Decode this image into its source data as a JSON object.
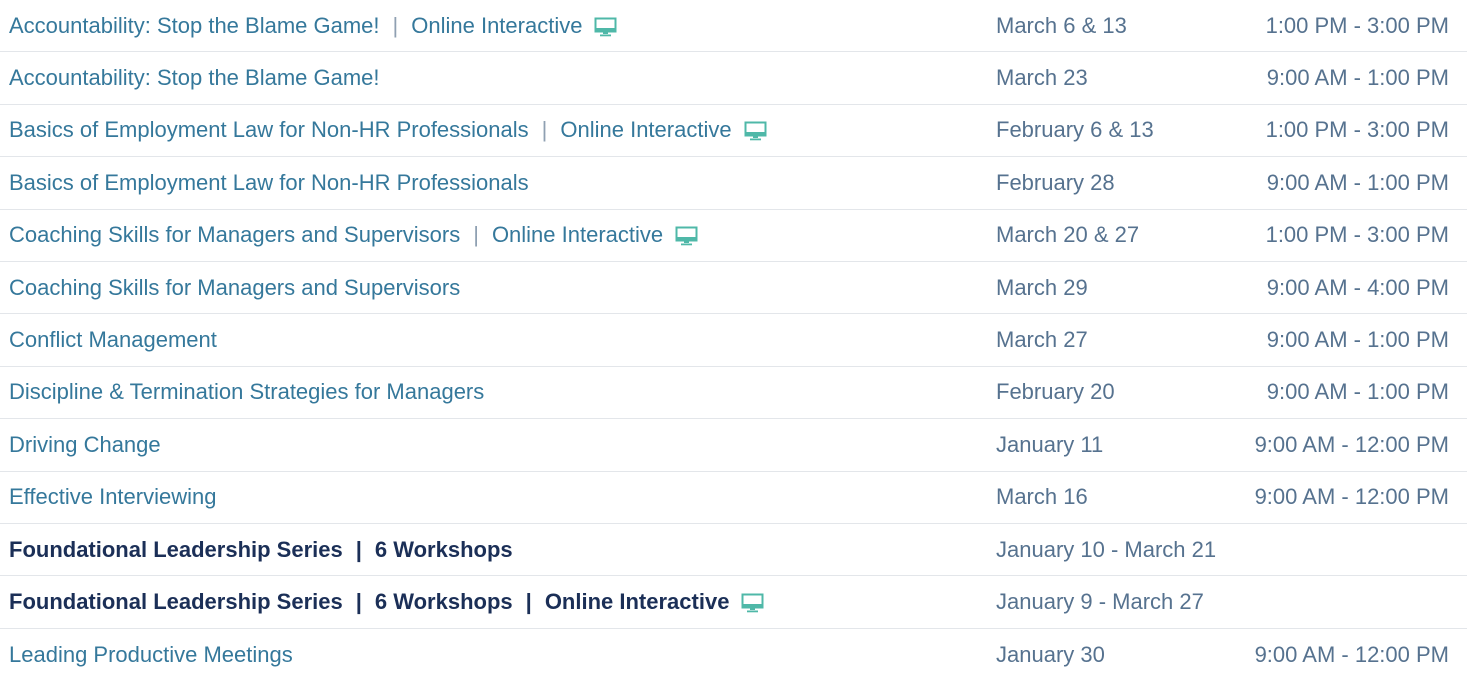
{
  "accent_color": "#4fb8a8",
  "rows": [
    {
      "title": "Accountability: Stop the Blame Game!",
      "series": "",
      "online": "Online Interactive",
      "date": "March 6 & 13",
      "time": "1:00 PM - 3:00 PM"
    },
    {
      "title": "Accountability: Stop the Blame Game!",
      "series": "",
      "online": "",
      "date": "March 23",
      "time": "9:00 AM - 1:00 PM"
    },
    {
      "title": "Basics of Employment Law for Non-HR Professionals",
      "series": "",
      "online": "Online Interactive",
      "date": "February 6 & 13",
      "time": "1:00 PM - 3:00 PM"
    },
    {
      "title": "Basics of Employment Law for Non-HR Professionals",
      "series": "",
      "online": "",
      "date": "February 28",
      "time": "9:00 AM - 1:00 PM"
    },
    {
      "title": "Coaching Skills for Managers and Supervisors",
      "series": "",
      "online": "Online Interactive",
      "date": "March 20 & 27",
      "time": "1:00 PM - 3:00 PM"
    },
    {
      "title": "Coaching Skills for Managers and Supervisors",
      "series": "",
      "online": "",
      "date": "March 29",
      "time": "9:00 AM - 4:00 PM"
    },
    {
      "title": "Conflict Management",
      "series": "",
      "online": "",
      "date": "March 27",
      "time": "9:00 AM - 1:00 PM"
    },
    {
      "title": "Discipline & Termination Strategies for Managers",
      "series": "",
      "online": "",
      "date": "February 20",
      "time": "9:00 AM - 1:00 PM"
    },
    {
      "title": "Driving Change",
      "series": "",
      "online": "",
      "date": "January 11",
      "time": "9:00 AM - 12:00 PM"
    },
    {
      "title": "Effective Interviewing",
      "series": "",
      "online": "",
      "date": "March 16",
      "time": "9:00 AM - 12:00 PM"
    },
    {
      "title": "Foundational Leadership Series",
      "series": "6 Workshops",
      "online": "",
      "date": "January 10 - March 21",
      "time": ""
    },
    {
      "title": "Foundational Leadership Series",
      "series": "6 Workshops",
      "online": "Online Interactive",
      "date": "January 9 - March 27",
      "time": ""
    },
    {
      "title": "Leading Productive Meetings",
      "series": "",
      "online": "",
      "date": "January 30",
      "time": "9:00 AM - 12:00 PM"
    }
  ],
  "separator": "|",
  "icons": {
    "online": "monitor-icon"
  }
}
